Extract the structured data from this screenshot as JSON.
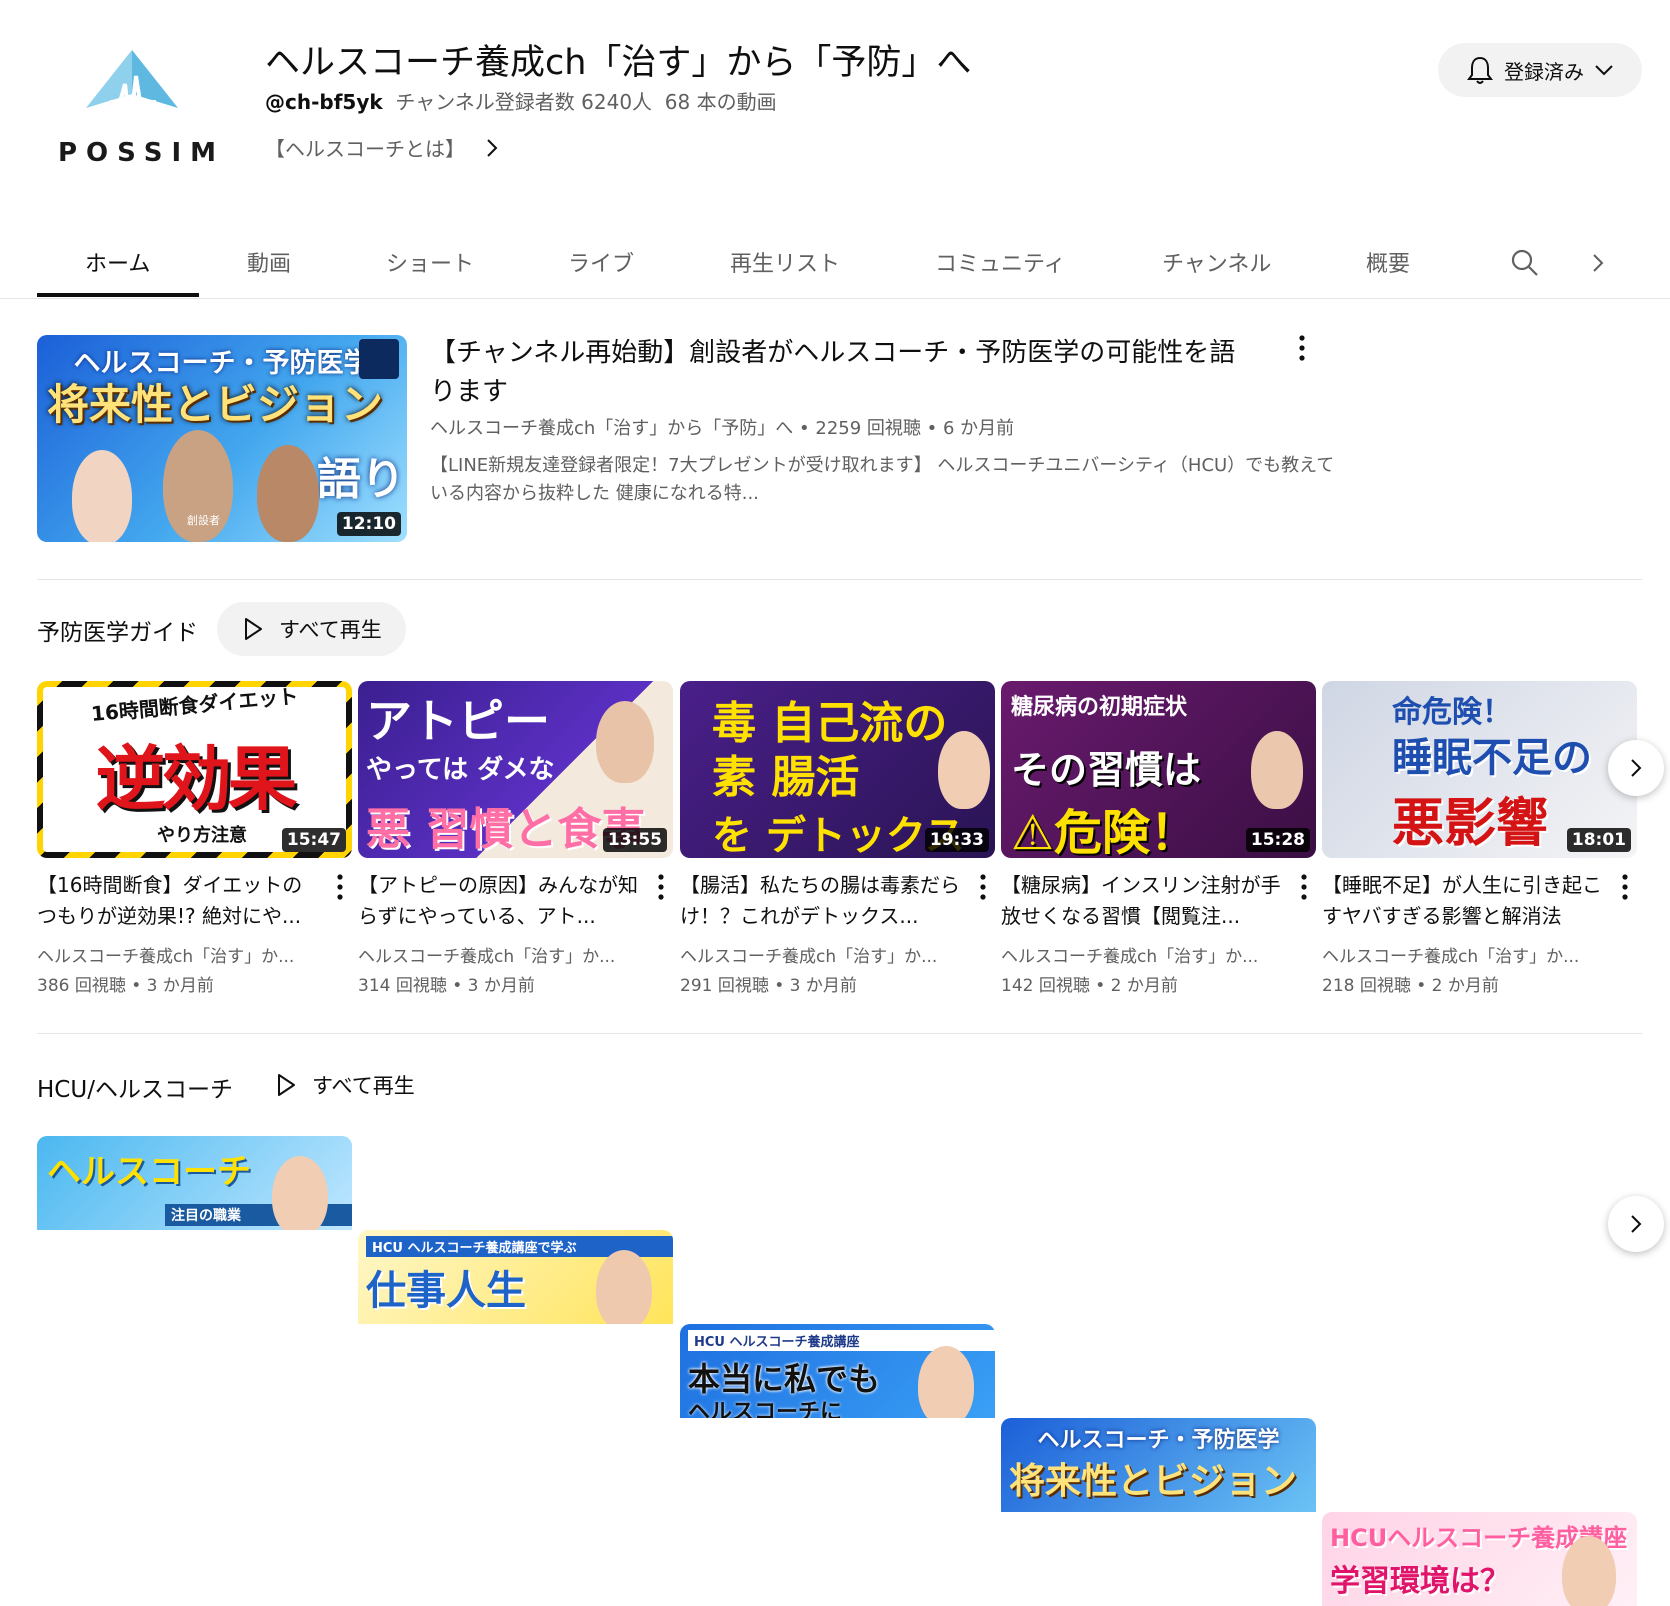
{
  "channel": {
    "logo_text": "POSSIM",
    "title": "ヘルスコーチ養成ch「治す」から「予防」へ",
    "handle": "@ch-bf5yk",
    "subscribers": "チャンネル登録者数 6240人",
    "video_count": "68 本の動画",
    "link_text": "【ヘルスコーチとは】",
    "subscribe_label": "登録済み"
  },
  "tabs": [
    {
      "label": "ホーム"
    },
    {
      "label": "動画"
    },
    {
      "label": "ショート"
    },
    {
      "label": "ライブ"
    },
    {
      "label": "再生リスト"
    },
    {
      "label": "コミュニティ"
    },
    {
      "label": "チャンネル"
    },
    {
      "label": "概要"
    }
  ],
  "featured": {
    "title": "【チャンネル再始動】創設者がヘルスコーチ・予防医学の可能性を語ります",
    "meta": "ヘルスコーチ養成ch「治す」から「予防」へ • 2259 回視聴 • 6 か月前",
    "description": "【LINE新規友達登録者限定！7大プレゼントが受け取れます】 ヘルスコーチユニバーシティ（HCU）でも教えている内容から抜粋した 健康になれる特...",
    "duration": "12:10",
    "thumb_line1": "ヘルスコーチ・予防医学",
    "thumb_line2": "将来性とビジョン",
    "thumb_line3": "語りま",
    "thumb_tag": "創設者"
  },
  "shelf1": {
    "title": "予防医学ガイド",
    "play_all": "すべて再生",
    "videos": [
      {
        "title": "【16時間断食】ダイエットのつもりが逆効果!? 絶対にや...",
        "channel": "ヘルスコーチ養成ch「治す」か...",
        "stats": "386 回視聴 • 3 か月前",
        "duration": "15:47",
        "t1": "16時間断食ダイエット",
        "t2": "逆効果",
        "t3": "やり方注意"
      },
      {
        "title": "【アトピーの原因】みんなが知らずにやっている、アト...",
        "channel": "ヘルスコーチ養成ch「治す」か...",
        "stats": "314 回視聴 • 3 か月前",
        "duration": "13:55",
        "t1": "アトピー",
        "t2": "やっては ダメな",
        "t3": "悪 習慣と食事"
      },
      {
        "title": "【腸活】私たちの腸は毒素だらけ！？これがデトックス...",
        "channel": "ヘルスコーチ養成ch「治す」か...",
        "stats": "291 回視聴 • 3 か月前",
        "duration": "19:33",
        "t1": "毒 自己流の",
        "t2": "素 腸活",
        "t3": "を デトックス"
      },
      {
        "title": "【糖尿病】インスリン注射が手放せくなる習慣【閲覧注...",
        "channel": "ヘルスコーチ養成ch「治す」か...",
        "stats": "142 回視聴 • 2 か月前",
        "duration": "15:28",
        "t1": "糖尿病の初期症状",
        "t2": "その習慣は",
        "t3": "⚠危険！"
      },
      {
        "title": "【睡眠不足】が人生に引き起こすヤバすぎる影響と解消法",
        "channel": "ヘルスコーチ養成ch「治す」か...",
        "stats": "218 回視聴 • 2 か月前",
        "duration": "18:01",
        "t1": "命危険！",
        "t2": "睡眠不足の",
        "t3": "悪影響"
      }
    ]
  },
  "shelf2": {
    "title": "HCU/ヘルスコーチ",
    "play_all": "すべて再生",
    "videos": [
      {
        "t1": "ヘルスコーチ",
        "t2": "注目の職業"
      },
      {
        "t1": "HCU ヘルスコーチ養成講座で学ぶ",
        "t2": "仕事人生"
      },
      {
        "t1": "HCU ヘルスコーチ養成講座",
        "t2": "本当に私でも",
        "t3": "ヘルスコーチに"
      },
      {
        "t1": "ヘルスコーチ・予防医学",
        "t2": "将来性とビジョン"
      },
      {
        "t1": "HCUヘルスコーチ養成講座",
        "t2": "学習環境は？"
      }
    ]
  }
}
